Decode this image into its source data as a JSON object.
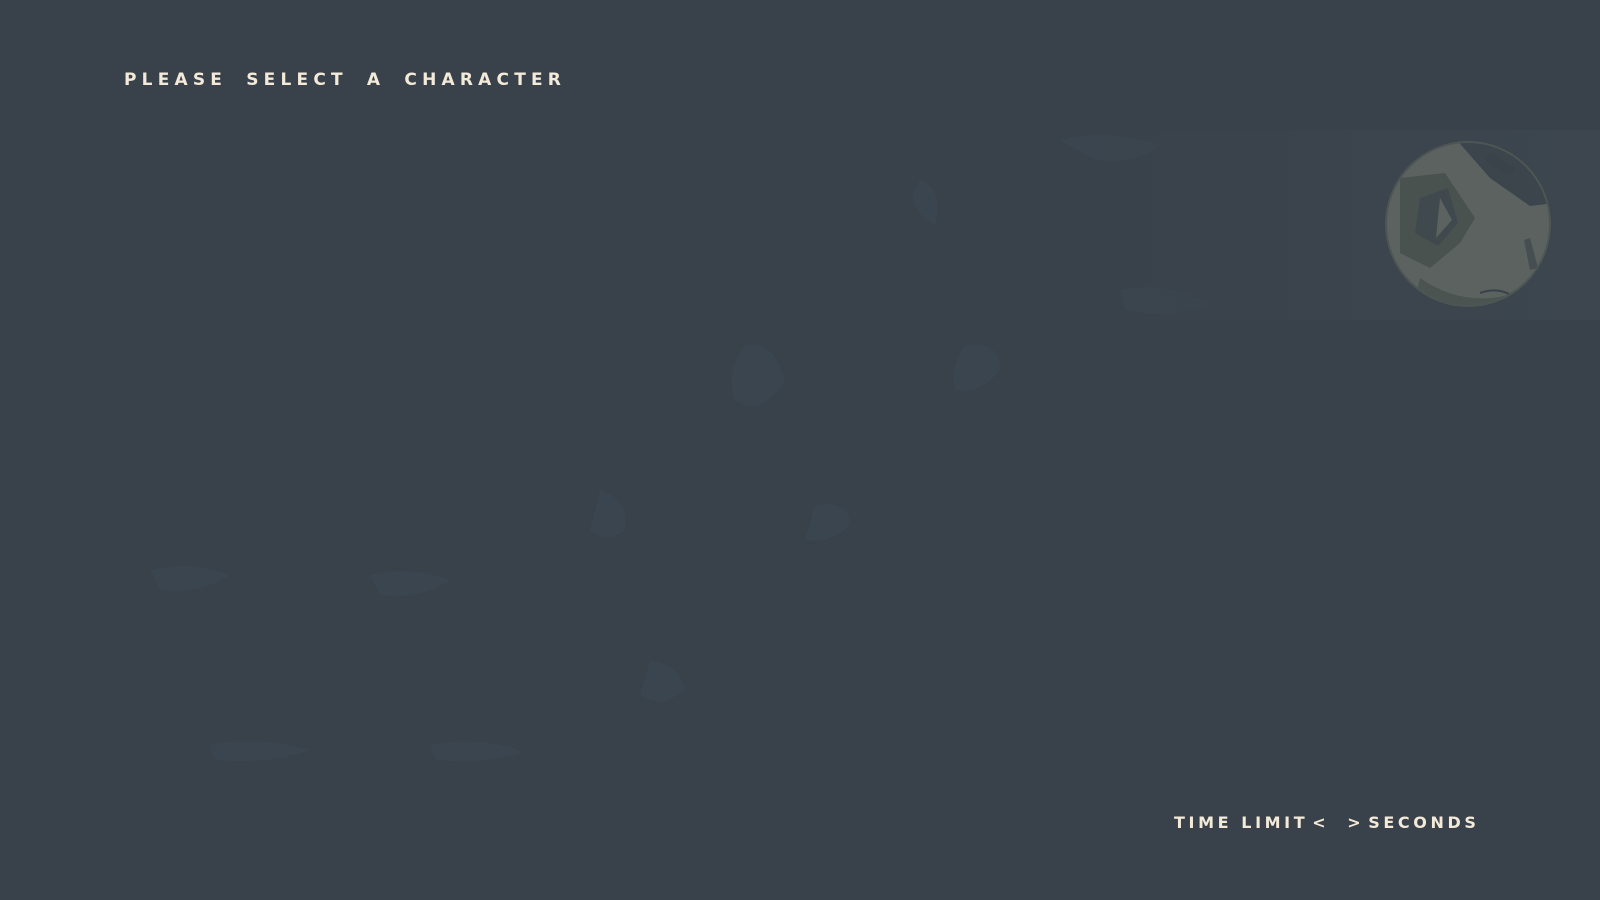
{
  "header": {
    "title": "PLEASE SELECT A CHARACTER"
  },
  "portrait": {
    "icon": "astronaut-helmet-icon",
    "tint": "#5b625f"
  },
  "time_limit": {
    "label": "TIME LIMIT",
    "decrease_glyph": "<",
    "value": "",
    "increase_glyph": ">",
    "unit": "SECONDS"
  },
  "colors": {
    "background": "#39414a",
    "text": "#f3ead9",
    "ghost": "#3c4650"
  }
}
